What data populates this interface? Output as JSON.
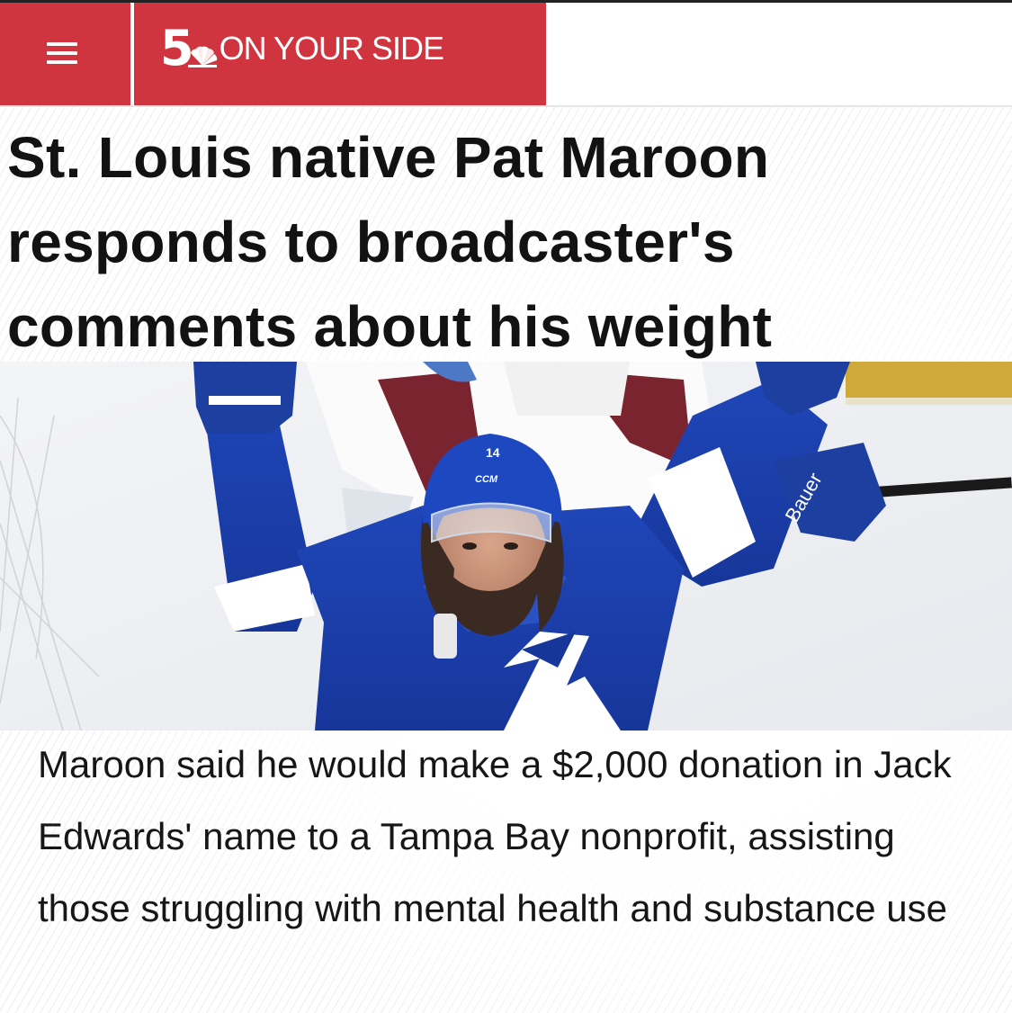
{
  "header": {
    "brand_color": "#cf343f",
    "menu_icon": "hamburger-menu-icon",
    "logo": {
      "number": "5",
      "icon": "peacock-icon",
      "text": "ON YOUR SIDE"
    }
  },
  "article": {
    "headline": "St. Louis native Pat Maroon responds to broadcaster's comments about his weight",
    "photo": {
      "helmet_number": "14",
      "helmet_brand": "CCM",
      "glove_brand": "Bauer"
    },
    "summary": "Maroon said he would make a $2,000 donation in Jack Edwards' name to a Tampa Bay nonprofit, assisting those struggling with mental health and substance use"
  }
}
